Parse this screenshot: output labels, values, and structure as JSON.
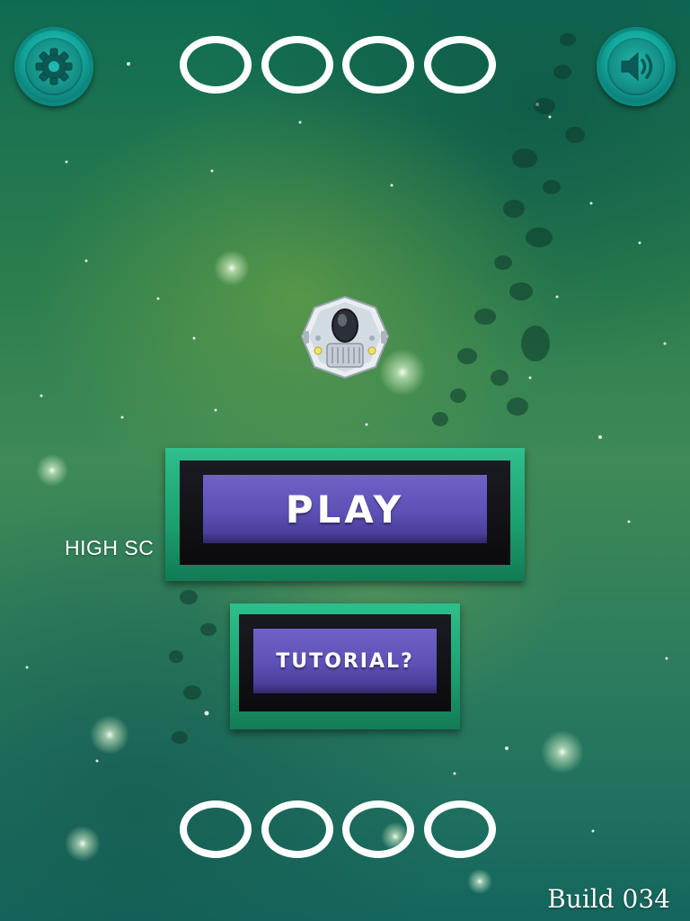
{
  "hud": {
    "settings_icon": "gear-icon",
    "sound_icon": "speaker-icon",
    "score_digits": [
      "0",
      "0",
      "0",
      "0"
    ]
  },
  "menu": {
    "play_label": "PLAY",
    "tutorial_label": "TUTORIAL?",
    "high_score_label": "HIGH SC",
    "high_score_digits": [
      "0",
      "0",
      "0",
      "0"
    ]
  },
  "footer": {
    "build_label": "Build 034"
  },
  "colors": {
    "button_border": "#1b9e6e",
    "button_face": "#5d50b6",
    "hud_button": "#13a79c",
    "text": "#ffffff"
  }
}
